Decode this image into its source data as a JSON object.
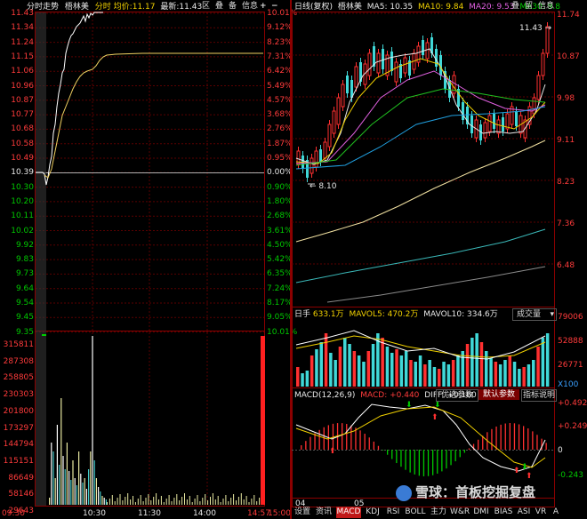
{
  "intraday": {
    "header": {
      "title": "分时走势",
      "name": "梧林美",
      "label1": "分时",
      "label2": "均价:",
      "avg": "11.17",
      "label3": "最新:",
      "latest": "11.43"
    },
    "buttons": [
      "区",
      "叠",
      "备",
      "信息"
    ],
    "price_ticks": [
      "11.43",
      "11.34",
      "11.24",
      "11.15",
      "11.06",
      "10.96",
      "10.87",
      "10.77",
      "10.68",
      "10.58",
      "10.49",
      "10.39",
      "10.30",
      "10.20",
      "10.11",
      "10.02",
      "9.92",
      "9.83",
      "9.73",
      "9.64",
      "9.54",
      "9.45",
      "9.35"
    ],
    "pct_ticks": [
      "10.01%",
      "9.12%",
      "8.23%",
      "7.31%",
      "6.42%",
      "5.49%",
      "4.57%",
      "3.68%",
      "2.76%",
      "1.87%",
      "0.95%",
      "0.00%",
      "0.90%",
      "1.80%",
      "2.68%",
      "3.61%",
      "4.50%",
      "5.42%",
      "6.35%",
      "7.24%",
      "8.17%",
      "9.05%",
      "10.01%"
    ],
    "vol_ticks": [
      "315811",
      "287308",
      "258805",
      "230303",
      "201800",
      "173297",
      "144794",
      "115151",
      "86649",
      "58146",
      "29643"
    ],
    "time_ticks": [
      "09:30",
      "10:30",
      "11:30",
      "14:00",
      "14:57",
      "15:00"
    ]
  },
  "daily": {
    "header": {
      "title": "日线(复权)",
      "name": "梧林美",
      "ma5": "MA5: 10.35",
      "ma10": "MA10: 9.84",
      "ma20": "MA20: 9.53",
      "ma30": "MA30: 9.8"
    },
    "buttons": [
      "叠",
      "留",
      "信息"
    ],
    "price_ticks": [
      "11.74",
      "10.87",
      "9.98",
      "9.11",
      "8.23",
      "7.36",
      "6.48"
    ],
    "low_label": "8.10",
    "high_label": "11.43",
    "vol_header": {
      "title": "日手",
      "v": "633.1万",
      "vma5": "MAVOL5: 470.2万",
      "vma10": "MAVOL10: 334.6万",
      "dropdown": "成交量"
    },
    "vol_ticks": [
      "79006",
      "52888",
      "26771"
    ],
    "vol_unit": "X100",
    "macd_header": {
      "title": "MACD(12,26,9)",
      "macd": "MACD: +0.440",
      "diff": "DIFF: +0.160",
      "opt1": "优选参数",
      "opt2": "默认参数",
      "opt3": "指标说明"
    },
    "macd_ticks": [
      "+0.492",
      "+0.249",
      "0",
      "-0.243"
    ],
    "date_ticks": [
      "04",
      "05"
    ]
  },
  "tabs": [
    "设置",
    "资讯",
    "MACD",
    "KDJ",
    "RSI",
    "BOLL",
    "主力",
    "W&R",
    "DMI",
    "BIAS",
    "ASI",
    "VR",
    "A"
  ],
  "watermark": "雪球：首板挖掘复盘"
}
